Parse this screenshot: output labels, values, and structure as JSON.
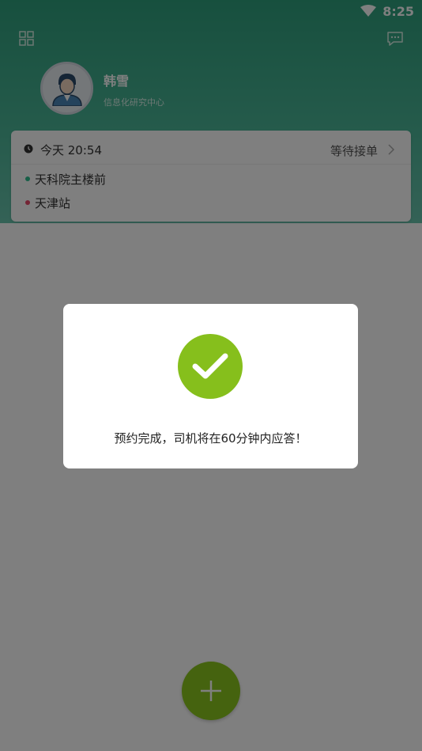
{
  "status_bar": {
    "time": "8:25",
    "wifi_icon": "wifi-icon"
  },
  "header": {
    "menu_icon": "grid-icon",
    "message_icon": "chat-icon",
    "user": {
      "name": "韩雪",
      "department": "信息化研究中心",
      "avatar_icon": "user-avatar-icon"
    }
  },
  "order_card": {
    "time_icon": "clock-icon",
    "time": "今天 20:54",
    "status": "等待接单",
    "origin": "天科院主楼前",
    "destination": "天津站"
  },
  "fab": {
    "icon": "plus-icon"
  },
  "dialog": {
    "icon": "check-icon",
    "message": "预约完成，司机将在60分钟内应答！"
  },
  "colors": {
    "header_gradient_top": "#2fa07d",
    "accent_green": "#86bf1c",
    "origin_dot": "#2fbf8f",
    "destination_dot": "#e84b6a"
  }
}
